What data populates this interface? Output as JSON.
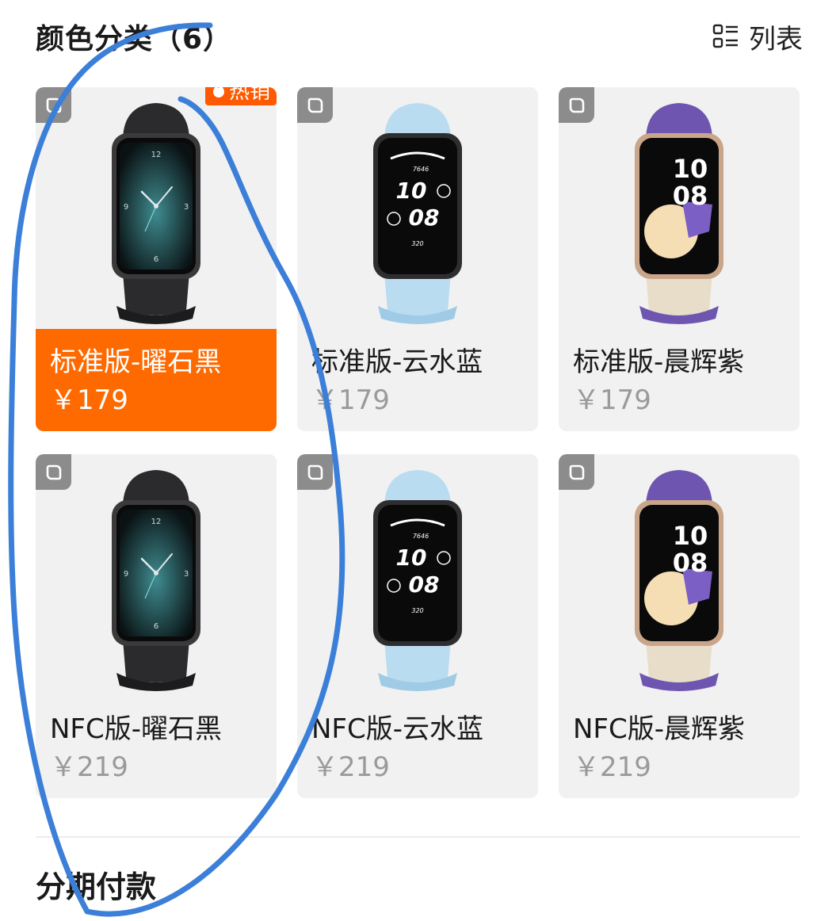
{
  "header": {
    "title": "颜色分类（6）",
    "view_label": "列表"
  },
  "products": [
    {
      "name": "标准版-曜石黑",
      "price": "￥179",
      "color": "black",
      "selected": true,
      "badge": "热销"
    },
    {
      "name": "标准版-云水蓝",
      "price": "￥179",
      "color": "blue",
      "selected": false,
      "badge": ""
    },
    {
      "name": "标准版-晨辉紫",
      "price": "￥179",
      "color": "purple",
      "selected": false,
      "badge": ""
    },
    {
      "name": "NFC版-曜石黑",
      "price": "￥219",
      "color": "black",
      "selected": false,
      "badge": ""
    },
    {
      "name": "NFC版-云水蓝",
      "price": "￥219",
      "color": "blue",
      "selected": false,
      "badge": ""
    },
    {
      "name": "NFC版-晨辉紫",
      "price": "￥219",
      "color": "purple",
      "selected": false,
      "badge": ""
    }
  ],
  "watch_faces": {
    "black": {
      "top": "12",
      "side_r": "3",
      "side_l": "9",
      "bottom": "6"
    },
    "blue": {
      "steps": "7646",
      "hour": "10",
      "min": "08",
      "cal": "320"
    },
    "purple": {
      "hour": "10",
      "min": "08"
    }
  },
  "section": {
    "installment_title": "分期付款"
  },
  "colors": {
    "accent": "#ff6a00",
    "card_bg": "#f1f1f1",
    "annotation": "#3b7fd9"
  },
  "icons": {
    "view": "list-view-icon",
    "zoom": "expand-icon",
    "hot": "flame-icon"
  }
}
